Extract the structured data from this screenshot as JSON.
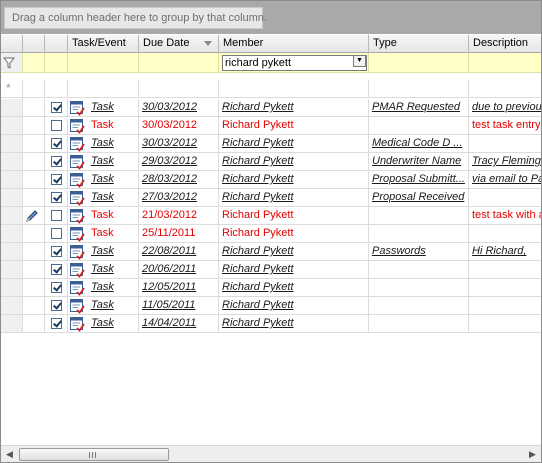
{
  "group_panel": {
    "hint": "Drag a column header here to group by that column."
  },
  "columns": {
    "task": "Task/Event",
    "due": "Due Date",
    "member": "Member",
    "type": "Type",
    "desc": "Description"
  },
  "filter": {
    "member_value": "richard pykett"
  },
  "icons": {
    "filter": "funnel-icon",
    "new_row": "asterisk-icon",
    "sort": "sort-descending-icon",
    "edit": "pencil-icon",
    "task": "task-icon"
  },
  "rows": [
    {
      "checked": true,
      "task": "Task",
      "due": "30/03/2012",
      "member": "Richard Pykett",
      "type": "PMAR Requested",
      "desc": "due to previou",
      "style": "normal"
    },
    {
      "checked": false,
      "task": "Task",
      "due": "30/03/2012",
      "member": "Richard Pykett",
      "type": "",
      "desc": "test task entry",
      "style": "red"
    },
    {
      "checked": true,
      "task": "Task",
      "due": "30/03/2012",
      "member": "Richard Pykett",
      "type": "Medical Code D ...",
      "desc": "",
      "style": "normal"
    },
    {
      "checked": true,
      "task": "Task",
      "due": "29/03/2012",
      "member": "Richard Pykett",
      "type": "Underwriter Name",
      "desc": "Tracy Fleming",
      "style": "normal"
    },
    {
      "checked": true,
      "task": "Task",
      "due": "28/03/2012",
      "member": "Richard Pykett",
      "type": "Proposal Submitt...",
      "desc": "via email to Pa",
      "style": "normal"
    },
    {
      "checked": true,
      "task": "Task",
      "due": "27/03/2012",
      "member": "Richard Pykett",
      "type": "Proposal Received",
      "desc": "",
      "style": "normal"
    },
    {
      "checked": false,
      "task": "Task",
      "due": "21/03/2012",
      "member": "Richard Pykett",
      "type": "",
      "desc": "test task with a",
      "style": "red",
      "editing": true
    },
    {
      "checked": false,
      "task": "Task",
      "due": "25/11/2011",
      "member": "Richard Pykett",
      "type": "",
      "desc": "",
      "style": "red"
    },
    {
      "checked": true,
      "task": "Task",
      "due": "22/08/2011",
      "member": "Richard Pykett",
      "type": "Passwords",
      "desc": "Hi Richard,",
      "style": "normal"
    },
    {
      "checked": true,
      "task": "Task",
      "due": "20/06/2011",
      "member": "Richard Pykett",
      "type": "",
      "desc": "",
      "style": "normal"
    },
    {
      "checked": true,
      "task": "Task",
      "due": "12/05/2011",
      "member": "Richard Pykett",
      "type": "",
      "desc": "",
      "style": "normal"
    },
    {
      "checked": true,
      "task": "Task",
      "due": "11/05/2011",
      "member": "Richard Pykett",
      "type": "",
      "desc": "",
      "style": "normal"
    },
    {
      "checked": true,
      "task": "Task",
      "due": "14/04/2011",
      "member": "Richard Pykett",
      "type": "",
      "desc": "",
      "style": "normal"
    }
  ]
}
